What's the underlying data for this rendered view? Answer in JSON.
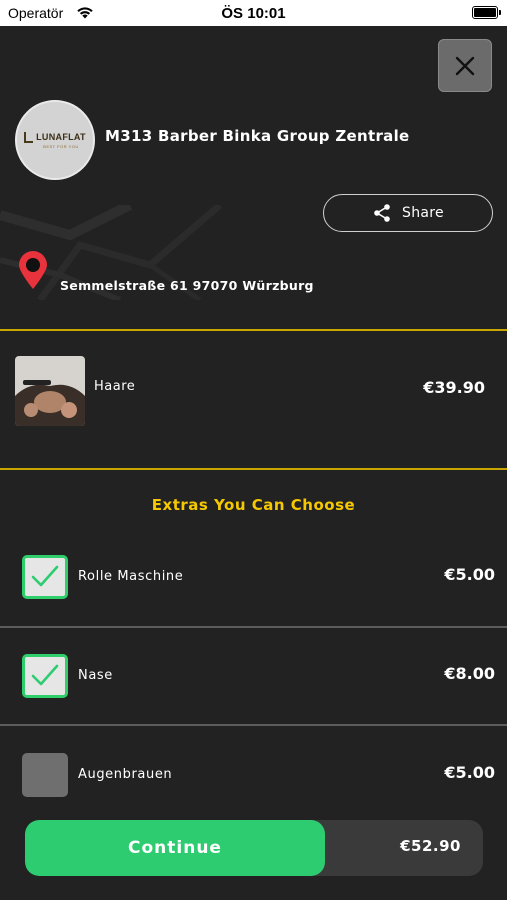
{
  "status_bar": {
    "carrier": "Operatör",
    "time": "ÖS 10:01"
  },
  "shop": {
    "logo_text": "LUNAFLAT",
    "logo_subtext": "BEST FOR YOU",
    "name": "M313 Barber Binka Group Zentrale",
    "address": "Semmelstraße 61 97070 Würzburg"
  },
  "share": {
    "label": "Share"
  },
  "service": {
    "name": "Haare",
    "price": "€39.90"
  },
  "extras": {
    "title": "Extras You Can Choose",
    "items": [
      {
        "label": "Rolle Maschine",
        "price": "€5.00",
        "checked": true
      },
      {
        "label": "Nase",
        "price": "€8.00",
        "checked": true
      },
      {
        "label": "Augenbrauen",
        "price": "€5.00",
        "checked": false
      }
    ]
  },
  "footer": {
    "continue_label": "Continue",
    "total": "€52.90"
  },
  "colors": {
    "background": "#222222",
    "accent_green": "#2ecc71",
    "accent_gold": "#c9a700",
    "title_yellow": "#f5c800",
    "pin_red": "#e8323c"
  }
}
